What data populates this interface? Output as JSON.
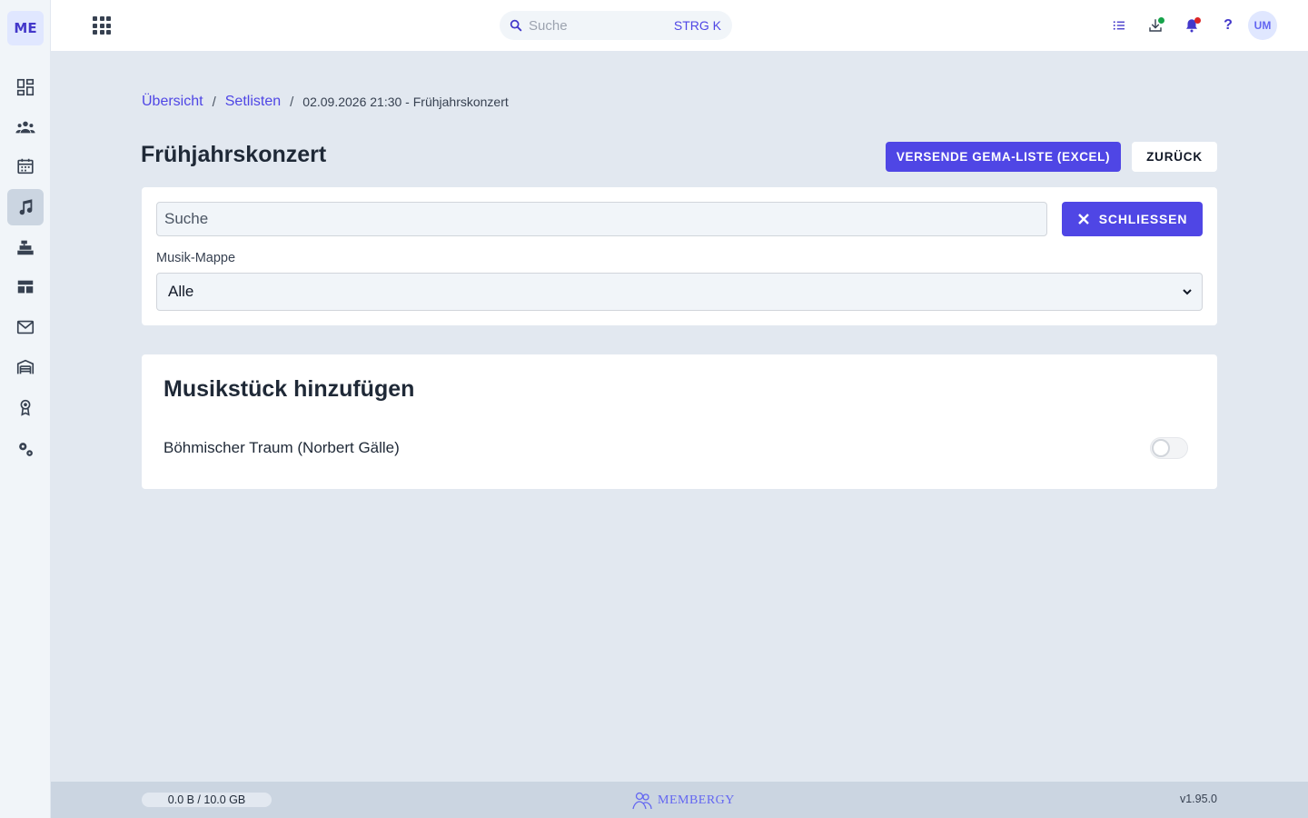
{
  "sidebar": {
    "logo": "ME",
    "items": [
      {
        "name": "dashboard-icon"
      },
      {
        "name": "members-icon"
      },
      {
        "name": "calendar-icon"
      },
      {
        "name": "music-icon",
        "active": true
      },
      {
        "name": "cash-register-icon"
      },
      {
        "name": "table-icon"
      },
      {
        "name": "mail-icon"
      },
      {
        "name": "warehouse-icon"
      },
      {
        "name": "award-icon"
      },
      {
        "name": "settings-icon"
      }
    ]
  },
  "topbar": {
    "search_placeholder": "Suche",
    "search_shortcut": "STRG K",
    "avatar": "UM",
    "icons": [
      "list-icon",
      "download-icon",
      "bell-icon",
      "help-icon"
    ],
    "help_glyph": "?"
  },
  "breadcrumb": {
    "items": [
      "Übersicht",
      "Setlisten"
    ],
    "separator": "/",
    "current": "02.09.2026 21:30 - Frühjahrskonzert"
  },
  "page": {
    "title": "Frühjahrskonzert",
    "primary_button": "VERSENDE GEMA-LISTE (EXCEL)",
    "back_button": "ZURÜCK"
  },
  "filter": {
    "search_placeholder": "Suche",
    "close_button": "SCHLIESSEN",
    "folder_label": "Musik-Mappe",
    "folder_value": "Alle"
  },
  "add_section": {
    "title": "Musikstück hinzufügen",
    "pieces": [
      {
        "label": "Böhmischer Traum (Norbert Gälle)",
        "enabled": false
      }
    ]
  },
  "footer": {
    "storage": "0.0 B / 10.0 GB",
    "brand": "MEMBERGY",
    "version": "v1.95.0"
  },
  "colors": {
    "accent": "#4f46e5",
    "background": "#e2e8f0",
    "footer": "#cbd5e1"
  }
}
